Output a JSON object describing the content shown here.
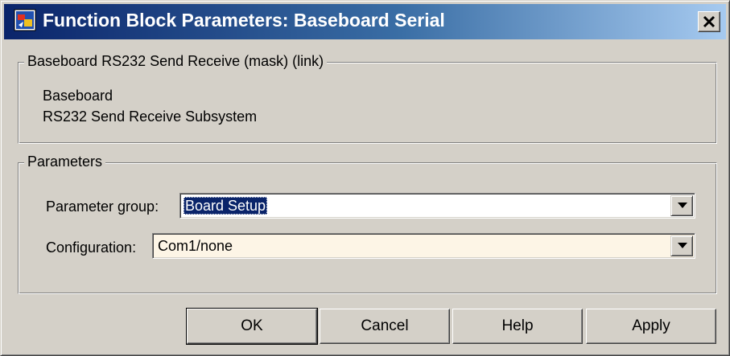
{
  "window": {
    "title": "Function Block Parameters: Baseboard Serial",
    "icon": "simulink-block-icon",
    "close_icon": "close-icon"
  },
  "description_group": {
    "legend": "Baseboard RS232 Send Receive (mask) (link)",
    "lines": [
      "Baseboard",
      "RS232 Send Receive Subsystem"
    ]
  },
  "parameters_group": {
    "legend": "Parameters",
    "parameter_group": {
      "label": "Parameter group:",
      "value": "Board Setup"
    },
    "configuration": {
      "label": "Configuration:",
      "value": "Com1/none"
    }
  },
  "buttons": {
    "ok": "OK",
    "cancel": "Cancel",
    "help": "Help",
    "apply": "Apply"
  },
  "colors": {
    "title_gradient_start": "#0a246a",
    "title_gradient_end": "#a6caf0",
    "dialog_face": "#d4d0c8",
    "combo_background": "#fdf5e6",
    "selection": "#0a246a"
  }
}
